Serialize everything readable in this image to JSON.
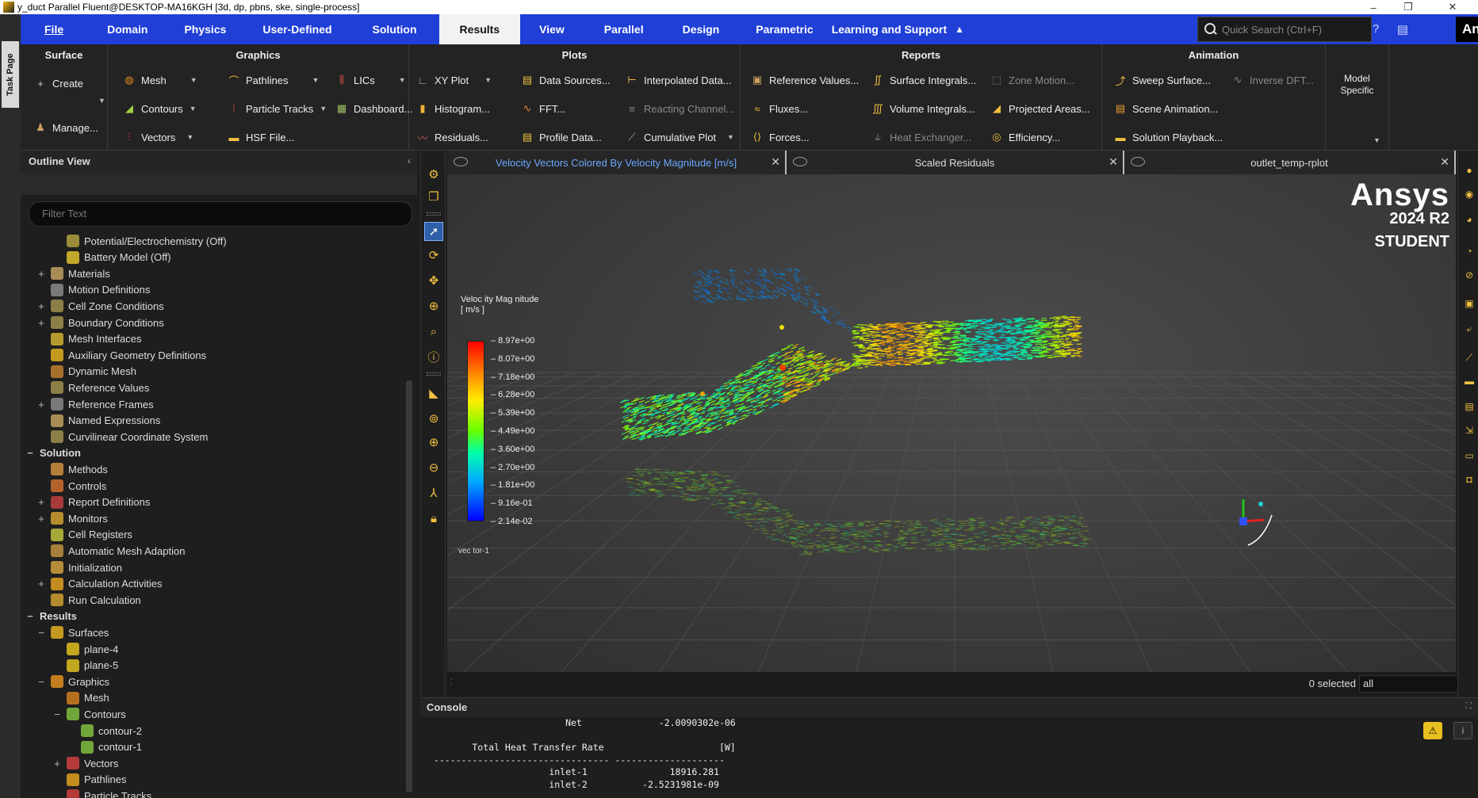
{
  "window": {
    "title": "y_duct Parallel Fluent@DESKTOP-MA16KGH  [3d, dp, pbns, ske, single-process]"
  },
  "task_page": {
    "label": "Task Page"
  },
  "menubar": {
    "items": [
      {
        "id": "file",
        "label": "File"
      },
      {
        "id": "domain",
        "label": "Domain"
      },
      {
        "id": "physics",
        "label": "Physics"
      },
      {
        "id": "user-defined",
        "label": "User-Defined"
      },
      {
        "id": "solution",
        "label": "Solution"
      },
      {
        "id": "results",
        "label": "Results"
      },
      {
        "id": "view",
        "label": "View"
      },
      {
        "id": "parallel",
        "label": "Parallel"
      },
      {
        "id": "design",
        "label": "Design"
      },
      {
        "id": "parametric",
        "label": "Parametric"
      },
      {
        "id": "learning",
        "label": "Learning and Support"
      }
    ],
    "active": "results",
    "search_placeholder": "Quick Search (Ctrl+F)",
    "brand": "Ansys"
  },
  "ribbon": {
    "surface": {
      "title": "Surface",
      "create": "Create",
      "manage": "Manage..."
    },
    "graphics": {
      "title": "Graphics",
      "mesh": "Mesh",
      "contours": "Contours",
      "vectors": "Vectors",
      "pathlines": "Pathlines",
      "particle_tracks": "Particle Tracks",
      "hsf_file": "HSF File...",
      "lics": "LICs",
      "dashboard": "Dashboard..."
    },
    "plots": {
      "title": "Plots",
      "xy_plot": "XY Plot",
      "histogram": "Histogram...",
      "residuals": "Residuals...",
      "data_sources": "Data Sources...",
      "fft": "FFT...",
      "profile_data": "Profile Data...",
      "interpolated_data": "Interpolated Data...",
      "reacting_channel": "Reacting Channel...",
      "cumulative_plot": "Cumulative Plot"
    },
    "reports": {
      "title": "Reports",
      "reference_values": "Reference Values...",
      "fluxes": "Fluxes...",
      "forces": "Forces...",
      "surface_integrals": "Surface Integrals...",
      "volume_integrals": "Volume Integrals...",
      "heat_exchanger": "Heat Exchanger...",
      "zone_motion": "Zone Motion...",
      "projected_areas": "Projected Areas...",
      "efficiency": "Efficiency..."
    },
    "animation": {
      "title": "Animation",
      "sweep_surface": "Sweep Surface...",
      "scene_animation": "Scene Animation...",
      "solution_playback": "Solution Playback...",
      "inverse_dft": "Inverse DFT..."
    },
    "model_specific": {
      "line1": "Model",
      "line2": "Specific"
    }
  },
  "outline": {
    "title": "Outline View",
    "filter_placeholder": "Filter Text",
    "rows": [
      {
        "label": "Potential/Electrochemistry (Off)",
        "indent": 3,
        "toggle": "",
        "bold": false,
        "icon": "grid-icon",
        "color": "#b0a040"
      },
      {
        "label": "Battery Model (Off)",
        "indent": 3,
        "toggle": "",
        "bold": false,
        "icon": "battery-icon",
        "color": "#e0c030"
      },
      {
        "label": "Materials",
        "indent": 2,
        "toggle": "+",
        "bold": false,
        "icon": "materials-icon",
        "color": "#c0a060"
      },
      {
        "label": "Motion Definitions",
        "indent": 2,
        "toggle": "",
        "bold": false,
        "icon": "motion-icon",
        "color": "#8a8a8a"
      },
      {
        "label": "Cell Zone Conditions",
        "indent": 2,
        "toggle": "+",
        "bold": false,
        "icon": "cellzone-icon",
        "color": "#a09050"
      },
      {
        "label": "Boundary Conditions",
        "indent": 2,
        "toggle": "+",
        "bold": false,
        "icon": "boundary-icon",
        "color": "#a09050"
      },
      {
        "label": "Mesh Interfaces",
        "indent": 2,
        "toggle": "",
        "bold": false,
        "icon": "interface-icon",
        "color": "#d0b030"
      },
      {
        "label": "Auxiliary Geometry Definitions",
        "indent": 2,
        "toggle": "",
        "bold": false,
        "icon": "geometry-icon",
        "color": "#e0b020"
      },
      {
        "label": "Dynamic Mesh",
        "indent": 2,
        "toggle": "",
        "bold": false,
        "icon": "dynamic-mesh-icon",
        "color": "#c08030"
      },
      {
        "label": "Reference Values",
        "indent": 2,
        "toggle": "",
        "bold": false,
        "icon": "reference-icon",
        "color": "#a09050"
      },
      {
        "label": "Reference Frames",
        "indent": 2,
        "toggle": "+",
        "bold": false,
        "icon": "frames-icon",
        "color": "#8a8a8a"
      },
      {
        "label": "Named Expressions",
        "indent": 2,
        "toggle": "",
        "bold": false,
        "icon": "expression-icon",
        "color": "#c0a060"
      },
      {
        "label": "Curvilinear Coordinate System",
        "indent": 2,
        "toggle": "",
        "bold": false,
        "icon": "coordinate-icon",
        "color": "#a09050"
      },
      {
        "label": "Solution",
        "indent": 1,
        "toggle": "−",
        "bold": true,
        "icon": "",
        "color": ""
      },
      {
        "label": "Methods",
        "indent": 2,
        "toggle": "",
        "bold": false,
        "icon": "methods-icon",
        "color": "#d09040"
      },
      {
        "label": "Controls",
        "indent": 2,
        "toggle": "",
        "bold": false,
        "icon": "controls-icon",
        "color": "#d07030"
      },
      {
        "label": "Report Definitions",
        "indent": 2,
        "toggle": "+",
        "bold": false,
        "icon": "report-icon",
        "color": "#c04040"
      },
      {
        "label": "Monitors",
        "indent": 2,
        "toggle": "+",
        "bold": false,
        "icon": "monitor-icon",
        "color": "#d0a030"
      },
      {
        "label": "Cell Registers",
        "indent": 2,
        "toggle": "",
        "bold": false,
        "icon": "register-icon",
        "color": "#c0c040"
      },
      {
        "label": "Automatic Mesh Adaption",
        "indent": 2,
        "toggle": "",
        "bold": false,
        "icon": "adaption-icon",
        "color": "#c09040"
      },
      {
        "label": "Initialization",
        "indent": 2,
        "toggle": "",
        "bold": false,
        "icon": "init-icon",
        "color": "#d0a040"
      },
      {
        "label": "Calculation Activities",
        "indent": 2,
        "toggle": "+",
        "bold": false,
        "icon": "activities-icon",
        "color": "#e0a020"
      },
      {
        "label": "Run Calculation",
        "indent": 2,
        "toggle": "",
        "bold": false,
        "icon": "run-icon",
        "color": "#d0a030"
      },
      {
        "label": "Results",
        "indent": 1,
        "toggle": "−",
        "bold": true,
        "icon": "",
        "color": ""
      },
      {
        "label": "Surfaces",
        "indent": 2,
        "toggle": "−",
        "bold": false,
        "icon": "surfaces-icon",
        "color": "#e0b020"
      },
      {
        "label": "plane-4",
        "indent": 3,
        "toggle": "",
        "bold": false,
        "icon": "plane-icon",
        "color": "#e0c020"
      },
      {
        "label": "plane-5",
        "indent": 3,
        "toggle": "",
        "bold": false,
        "icon": "plane-icon",
        "color": "#e0c020"
      },
      {
        "label": "Graphics",
        "indent": 2,
        "toggle": "−",
        "bold": false,
        "icon": "graphics-icon",
        "color": "#e09020"
      },
      {
        "label": "Mesh",
        "indent": 3,
        "toggle": "",
        "bold": false,
        "icon": "mesh-icon",
        "color": "#d08020"
      },
      {
        "label": "Contours",
        "indent": 3,
        "toggle": "−",
        "bold": false,
        "icon": "contours-icon",
        "color": "#80c040"
      },
      {
        "label": "contour-2",
        "indent": 4,
        "toggle": "",
        "bold": false,
        "icon": "contour-icon",
        "color": "#80c040"
      },
      {
        "label": "contour-1",
        "indent": 4,
        "toggle": "",
        "bold": false,
        "icon": "contour-icon",
        "color": "#80c040"
      },
      {
        "label": "Vectors",
        "indent": 3,
        "toggle": "+",
        "bold": false,
        "icon": "vectors-icon",
        "color": "#d04040"
      },
      {
        "label": "Pathlines",
        "indent": 3,
        "toggle": "",
        "bold": false,
        "icon": "pathlines-icon",
        "color": "#e0a020"
      },
      {
        "label": "Particle Tracks",
        "indent": 3,
        "toggle": "",
        "bold": false,
        "icon": "particle-icon",
        "color": "#d04040"
      }
    ]
  },
  "graphics_tabs": [
    {
      "label": "Velocity Vectors Colored By Velocity Magnitude [m/s]",
      "active": true
    },
    {
      "label": "Scaled Residuals",
      "active": false
    },
    {
      "label": "outlet_temp-rplot",
      "active": false
    }
  ],
  "viewport": {
    "logo": {
      "brand": "Ansys",
      "version": "2024 R2",
      "edition": "STUDENT"
    },
    "legend": {
      "title_line1": "Veloc ity Mag nitude",
      "title_line2": "[ m/s ]",
      "labels": [
        "8.97e+00",
        "8.07e+00",
        "7.18e+00",
        "6.28e+00",
        "5.39e+00",
        "4.49e+00",
        "3.60e+00",
        "2.70e+00",
        "1.81e+00",
        "9.16e-01",
        "2.14e-02"
      ]
    },
    "object_name": "vec tor-1"
  },
  "selection": {
    "status": "0 selected",
    "filter": "all"
  },
  "console": {
    "title": "Console",
    "lines": [
      "                         Net              -2.0090302e-06",
      "",
      "        Total Heat Transfer Rate                     [W]",
      " -------------------------------- --------------------",
      "                      inlet-1               18916.281",
      "                      inlet-2          -2.5231981e-09"
    ]
  },
  "colors": {
    "menubar": "#1f3fd6",
    "accent": "#6aa8ff",
    "warning": "#e8c020"
  }
}
